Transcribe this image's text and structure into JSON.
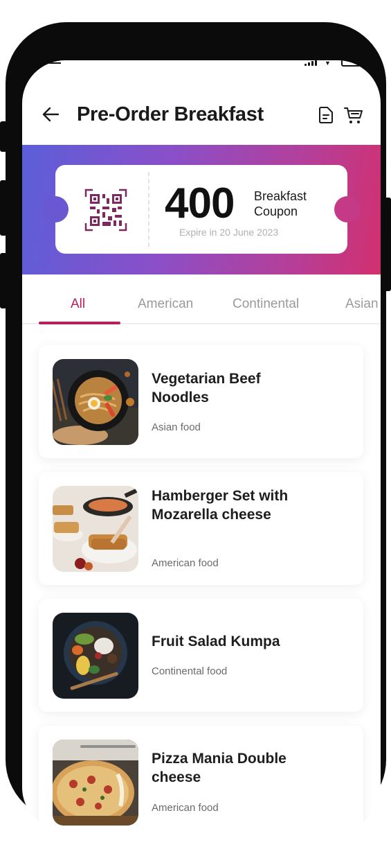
{
  "header": {
    "title": "Pre-Order Breakfast",
    "back_icon": "arrow-left-icon",
    "doc_icon": "document-icon",
    "cart_icon": "cart-icon"
  },
  "coupon": {
    "amount": "400",
    "label_line1": "Breakfast",
    "label_line2": "Coupon",
    "expiry": "Expire in 20 June 2023",
    "qr_icon": "qr-code-icon"
  },
  "colors": {
    "accent": "#b5205a",
    "banner_start": "#5b5fd9",
    "banner_end": "#d2306e"
  },
  "tabs": [
    {
      "label": "All",
      "active": true
    },
    {
      "label": "American",
      "active": false
    },
    {
      "label": "Continental",
      "active": false
    },
    {
      "label": "Asian",
      "active": false
    }
  ],
  "foods": [
    {
      "name": "Vegetarian Beef Noodles",
      "category": "Asian food",
      "image": "noodles-bowl"
    },
    {
      "name": "Hamberger Set with Mozarella cheese",
      "category": "American food",
      "image": "toast-plate"
    },
    {
      "name": "Fruit Salad Kumpa",
      "category": "Continental food",
      "image": "salad-bowl"
    },
    {
      "name": "Pizza Mania Double cheese",
      "category": "American food",
      "image": "pizza"
    }
  ]
}
